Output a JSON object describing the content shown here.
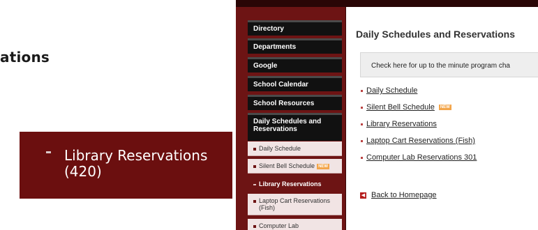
{
  "left_heading": "ations",
  "zoom": {
    "text_line1": "Library Reservations",
    "text_line2": "(420)"
  },
  "sidebar": {
    "nav": [
      {
        "label": "Directory"
      },
      {
        "label": "Departments"
      },
      {
        "label": "Google"
      },
      {
        "label": "School Calendar"
      },
      {
        "label": "School Resources"
      },
      {
        "label_line1": "Daily Schedules and",
        "label_line2": "Reservations"
      }
    ],
    "sub": {
      "daily_schedule": "Daily Schedule",
      "silent_bell": "Silent Bell Schedule",
      "new_badge": "NEW",
      "library_active": "Library Reservations",
      "laptop_line1": "Laptop Cart Reservations",
      "laptop_line2": "(Fish)",
      "computer_lab": "Computer Lab"
    }
  },
  "content": {
    "title": "Daily Schedules and Reservations",
    "notice": "Check here for up to the minute program cha",
    "links": [
      {
        "label": "Daily Schedule"
      },
      {
        "label": "Silent Bell Schedule",
        "badge": "NEW"
      },
      {
        "label": "Library Reservations"
      },
      {
        "label": "Laptop Cart Reservations (Fish)"
      },
      {
        "label": "Computer Lab Reservations 301"
      }
    ],
    "back_label": "Back to Homepage"
  },
  "colors": {
    "sidebar_bg": "#6d1414",
    "nav_bg": "#111111",
    "accent_badge": "#f3a54a",
    "back_icon": "#b51d1d"
  }
}
